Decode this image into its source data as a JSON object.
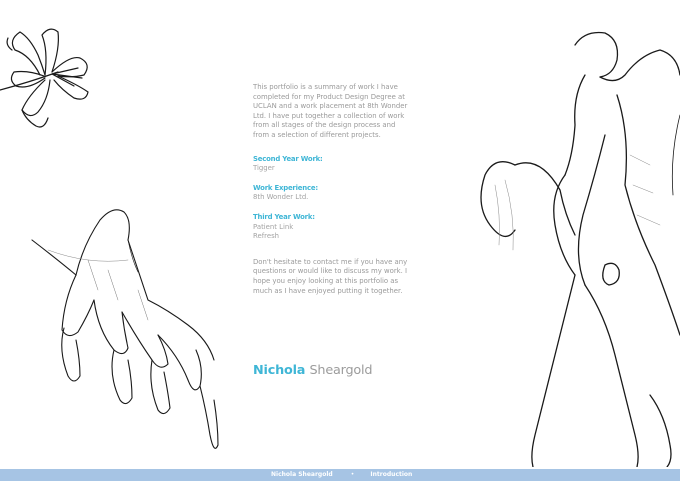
{
  "intro": {
    "paragraph": "This portfolio is a summary of work I have completed for my Product Design Degree at UCLAN and a work placement at 8th Wonder Ltd. I have put together a collection of work from all stages of the design process and from a selection of different projects."
  },
  "sections": [
    {
      "heading": "Second Year Work:",
      "items": [
        "Tigger"
      ]
    },
    {
      "heading": "Work Experience:",
      "items": [
        "8th Wonder Ltd."
      ]
    },
    {
      "heading": "Third Year Work:",
      "items": [
        "Patient Link",
        "Refresh"
      ]
    }
  ],
  "contact": {
    "paragraph": "Don't hesitate to contact me if you have any questions or would like to discuss my work. I hope you enjoy looking at this portfolio as much as I have enjoyed putting it together."
  },
  "author": {
    "first": "Nichola",
    "last": "Sheargold"
  },
  "footer": {
    "first": "Nichola",
    "last": "Sheargold",
    "separator": "•",
    "section": "Introduction"
  },
  "colors": {
    "accent": "#3fb6d6",
    "body_text": "#9a9a9a",
    "footer_bar": "#a6c4e4"
  },
  "illustrations": [
    "lily-flower-sketch",
    "hand-sketch",
    "dancing-figures-sketch"
  ]
}
